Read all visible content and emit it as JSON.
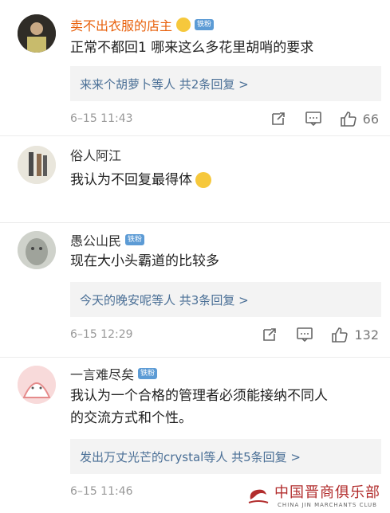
{
  "comments": [
    {
      "username": "卖不出衣服的店主",
      "emoji": "grinning-sweat-emoji",
      "badge": "铁粉",
      "text": "正常不都回1 哪来这么多花里胡哨的要求",
      "reply_summary": "来来个胡萝卜等人  共2条回复 >",
      "time": "6–15 11:43",
      "likes": "66"
    },
    {
      "username": "俗人阿江",
      "text": "我认为不回复最得体",
      "emoji": "shushing-face-emoji"
    },
    {
      "username": "愚公山民",
      "badge": "铁粉",
      "text": "现在大小头霸道的比较多",
      "reply_summary": "今天的晚安呢等人  共3条回复 >",
      "time": "6–15 12:29",
      "likes": "132"
    },
    {
      "username": "一言难尽矣",
      "badge": "铁粉",
      "text_line1": "我认为一个合格的管理者必须能接纳不同人",
      "text_line2": "的交流方式和个性。",
      "reply_summary": "发出万丈光芒的crystal等人  共5条回复 >",
      "time": "6–15 11:46"
    }
  ],
  "watermark": {
    "cn": "中国晋商俱乐部",
    "en": "CHINA JIN MARCHANTS CLUB"
  },
  "colors": {
    "username_highlight": "#e8600b",
    "reply_link": "#4a6f96",
    "badge_bg": "#5c9bd5",
    "watermark_red": "#b22d2d"
  }
}
